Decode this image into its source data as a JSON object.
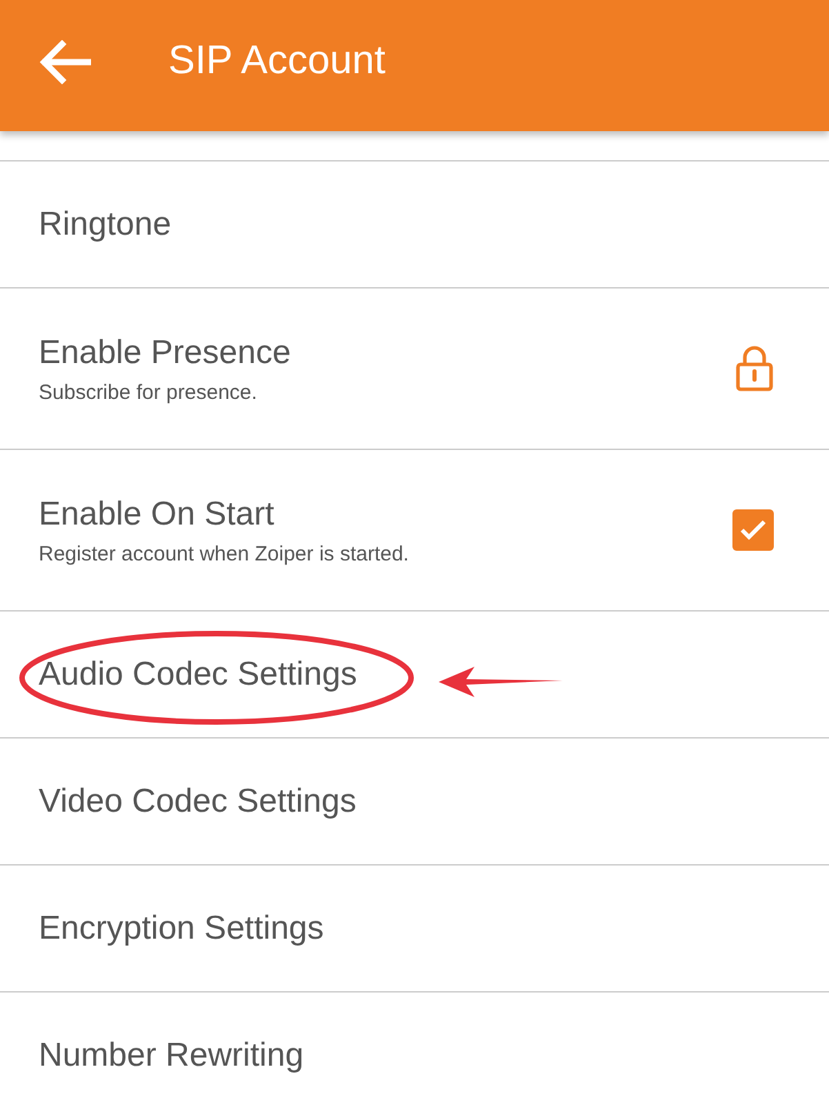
{
  "app_bar": {
    "title": "SIP Account"
  },
  "rows": [
    {
      "kind": "plain",
      "title": "Ringtone",
      "highlighted": false
    },
    {
      "kind": "lock",
      "title": "Enable Presence",
      "subtitle": "Subscribe for presence.",
      "highlighted": false
    },
    {
      "kind": "checkbox",
      "title": "Enable On Start",
      "subtitle": "Register account when Zoiper is started.",
      "checked": true,
      "highlighted": false
    },
    {
      "kind": "plain",
      "title": "Audio Codec Settings",
      "highlighted": true
    },
    {
      "kind": "plain",
      "title": "Video Codec Settings",
      "highlighted": false
    },
    {
      "kind": "plain",
      "title": "Encryption Settings",
      "highlighted": false
    },
    {
      "kind": "plain",
      "title": "Number Rewriting",
      "highlighted": false
    }
  ]
}
